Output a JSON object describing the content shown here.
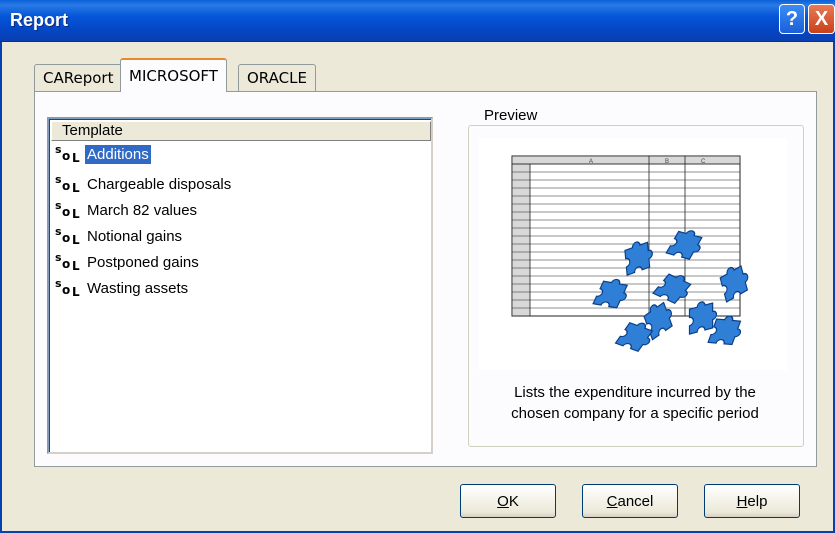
{
  "window": {
    "title": "Report"
  },
  "titlebar_buttons": {
    "help": "?",
    "close": "X"
  },
  "tabs": [
    {
      "label": "CAReport"
    },
    {
      "label": "MICROSOFT",
      "selected": true
    },
    {
      "label": "ORACLE"
    }
  ],
  "list": {
    "header": "Template",
    "icon": "sol-icon",
    "items": [
      {
        "label": "Additions",
        "selected": true
      },
      {
        "label": "Chargeable disposals"
      },
      {
        "label": "March 82 values"
      },
      {
        "label": "Notional gains"
      },
      {
        "label": "Postponed gains"
      },
      {
        "label": "Wasting assets"
      }
    ]
  },
  "preview": {
    "legend": "Preview",
    "caption_line1": "Lists the expenditure incurred by the",
    "caption_line2": "chosen company for a specific period",
    "spreadsheet_columns": [
      "A",
      "B",
      "C"
    ]
  },
  "buttons": {
    "ok": {
      "mnemonic": "O",
      "rest": "K"
    },
    "cancel": {
      "mnemonic": "C",
      "rest": "ancel"
    },
    "help": {
      "mnemonic": "H",
      "rest": "elp"
    }
  },
  "colors": {
    "titlebar": "#0555d8",
    "selection": "#316ac5",
    "puzzle": "#2f7fd6"
  }
}
